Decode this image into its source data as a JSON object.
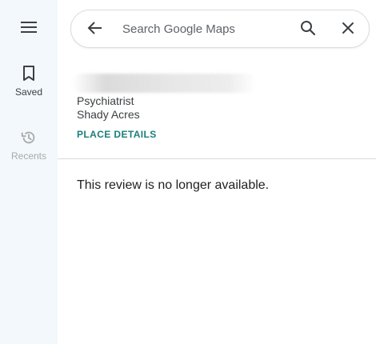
{
  "rail": {
    "menu_icon": "hamburger-menu-icon",
    "saved": {
      "label": "Saved",
      "icon": "bookmark-icon"
    },
    "recents": {
      "label": "Recents",
      "icon": "history-icon"
    }
  },
  "search": {
    "placeholder": "Search Google Maps",
    "value": "",
    "back_icon": "arrow-back-icon",
    "search_icon": "search-icon",
    "clear_icon": "close-icon"
  },
  "place": {
    "category": "Psychiatrist",
    "location": "Shady Acres",
    "details_link": "PLACE DETAILS"
  },
  "review": {
    "message": "This review is no longer available."
  },
  "colors": {
    "rail_background": "#f2f8fb",
    "link": "#1a7f7a",
    "text_primary": "#202124",
    "text_secondary": "#3c4043",
    "disabled": "#a9aaab",
    "divider": "#dadce0"
  }
}
